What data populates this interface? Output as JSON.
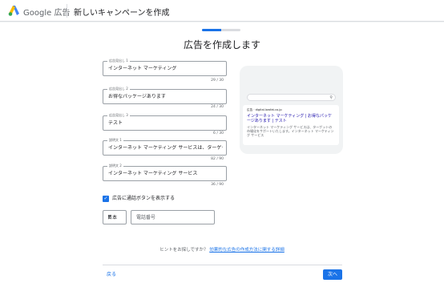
{
  "header": {
    "brand": "Google 広告",
    "page_title": "新しいキャンペーンを作成"
  },
  "progress": {
    "step": 2,
    "of": 4
  },
  "title": "広告を作成します",
  "fields": [
    {
      "label": "広告見出し 1",
      "value": "インターネット マーケティング",
      "counter": "29 / 30"
    },
    {
      "label": "広告見出し 2",
      "value": "お得なパッケージあります",
      "counter": "24 / 30"
    },
    {
      "label": "広告見出し 3",
      "value": "テスト",
      "counter": "6 / 30"
    },
    {
      "label": "説明文 1",
      "value": "インターネット マーケティング サービスは、ターゲット市場",
      "counter": "82 / 90"
    },
    {
      "label": "説明文 2",
      "value": "インターネット マーケティング サービス",
      "counter": "36 / 90"
    }
  ],
  "call_button": {
    "checked": true,
    "label": "広告に通話ボタンを表示する"
  },
  "phone": {
    "country": "日本",
    "placeholder": "電話番号"
  },
  "hint": {
    "text": "ヒントをお探しですか？",
    "link": "効果的な広告の作成方法に関する詳細"
  },
  "footer": {
    "back": "戻る",
    "next": "次へ"
  },
  "preview": {
    "url": "広告 · digital.lowfat.co.jp",
    "headline": "インターネット マーケティング | お得なパッケージあります | テスト",
    "description": "インターネット マーケティング サービスは、ターゲットの市場化をサポートいたします。インターネット マーケティング サービス"
  },
  "colors": {
    "accent": "#1a73e8",
    "border": "#9aa0a6",
    "preview_bg": "#f1f3f4"
  }
}
